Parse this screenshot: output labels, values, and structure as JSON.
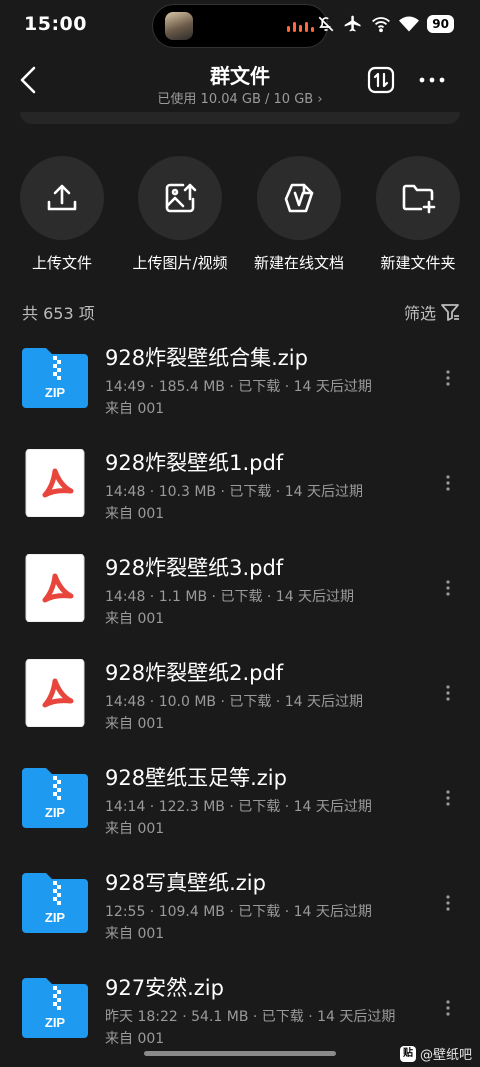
{
  "status": {
    "time": "15:00",
    "battery": "90",
    "icons": [
      "mute-bell-icon",
      "airplane-icon",
      "wifi-calling-icon",
      "wifi-icon"
    ]
  },
  "header": {
    "title": "群文件",
    "storage": "已使用 10.04 GB / 10 GB",
    "storage_chevron": "›",
    "back_icon": "back-arrow-icon",
    "sort_icon": "sort-icon",
    "more_icon": "more-dots-icon"
  },
  "actions": [
    {
      "label": "上传文件",
      "icon": "upload-icon"
    },
    {
      "label": "上传图片/视频",
      "icon": "upload-image-icon"
    },
    {
      "label": "新建在线文档",
      "icon": "online-doc-icon"
    },
    {
      "label": "新建文件夹",
      "icon": "new-folder-icon"
    }
  ],
  "list_header": {
    "count": "共 653 项",
    "filter": "筛选"
  },
  "files": [
    {
      "type": "zip",
      "name": "928炸裂壁纸合集.zip",
      "meta": "14:49 · 185.4 MB · 已下载 · 14 天后过期",
      "source": "来自 001",
      "badge": "ZIP"
    },
    {
      "type": "pdf",
      "name": "928炸裂壁纸1.pdf",
      "meta": "14:48 · 10.3 MB · 已下载 · 14 天后过期",
      "source": "来自 001"
    },
    {
      "type": "pdf",
      "name": "928炸裂壁纸3.pdf",
      "meta": "14:48 · 1.1 MB · 已下载 · 14 天后过期",
      "source": "来自 001"
    },
    {
      "type": "pdf",
      "name": "928炸裂壁纸2.pdf",
      "meta": "14:48 · 10.0 MB · 已下载 · 14 天后过期",
      "source": "来自 001"
    },
    {
      "type": "zip",
      "name": "928壁纸玉足等.zip",
      "meta": "14:14 · 122.3 MB · 已下载 · 14 天后过期",
      "source": "来自 001",
      "badge": "ZIP"
    },
    {
      "type": "zip",
      "name": "928写真壁纸.zip",
      "meta": "12:55 · 109.4 MB · 已下载 · 14 天后过期",
      "source": "来自 001",
      "badge": "ZIP"
    },
    {
      "type": "zip",
      "name": "927安然.zip",
      "meta": "昨天 18:22 · 54.1 MB · 已下载 · 14 天后过期",
      "source": "来自 001",
      "badge": "ZIP"
    }
  ],
  "watermark": {
    "logo": "贴",
    "text": "@壁纸吧"
  },
  "colors": {
    "background": "#1a1a1a",
    "zip_blue": "#1e9bf0",
    "pdf_red": "#e8463c",
    "circle": "#2c2c2c"
  }
}
